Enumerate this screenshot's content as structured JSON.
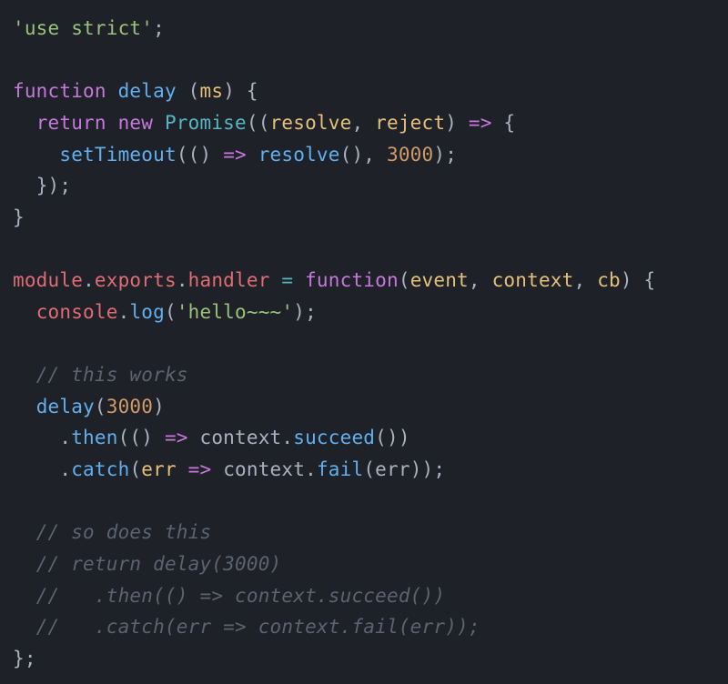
{
  "code": {
    "l1_str": "'use strict'",
    "l1_semi": ";",
    "l3_kw_function": "function",
    "l3_fn_delay": "delay",
    "l3_open": " (",
    "l3_ms": "ms",
    "l3_close": ") {",
    "l4_indent": "  ",
    "l4_return": "return",
    "l4_sp": " ",
    "l4_new": "new",
    "l4_sp2": " ",
    "l4_promise": "Promise",
    "l4_open": "((",
    "l4_resolve": "resolve",
    "l4_comma": ", ",
    "l4_reject": "reject",
    "l4_close": ") ",
    "l4_arrow": "=>",
    "l4_brace": " {",
    "l5_indent": "    ",
    "l5_setTimeout": "setTimeout",
    "l5_open": "(() ",
    "l5_arrow": "=>",
    "l5_sp": " ",
    "l5_resolve": "resolve",
    "l5_paren": "(), ",
    "l5_num": "3000",
    "l5_close": ");",
    "l6_indent": "  ",
    "l6_close": "});",
    "l7_close": "}",
    "l9_module": "module",
    "l9_dot1": ".",
    "l9_exports": "exports",
    "l9_dot2": ".",
    "l9_handler": "handler",
    "l9_sp": " ",
    "l9_eq": "=",
    "l9_sp2": " ",
    "l9_function": "function",
    "l9_open": "(",
    "l9_event": "event",
    "l9_c1": ", ",
    "l9_context": "context",
    "l9_c2": ", ",
    "l9_cb": "cb",
    "l9_close": ") {",
    "l10_indent": "  ",
    "l10_console": "console",
    "l10_dot": ".",
    "l10_log": "log",
    "l10_open": "(",
    "l10_str": "'hello~~~'",
    "l10_close": ");",
    "l12_indent": "  ",
    "l12_comment": "// this works",
    "l13_indent": "  ",
    "l13_delay": "delay",
    "l13_open": "(",
    "l13_num": "3000",
    "l13_close": ")",
    "l14_indent": "    ",
    "l14_dot": ".",
    "l14_then": "then",
    "l14_open": "(() ",
    "l14_arrow": "=>",
    "l14_sp": " ",
    "l14_context": "context",
    "l14_dot2": ".",
    "l14_succeed": "succeed",
    "l14_close": "())",
    "l15_indent": "    ",
    "l15_dot": ".",
    "l15_catch": "catch",
    "l15_open": "(",
    "l15_err": "err",
    "l15_sp": " ",
    "l15_arrow": "=>",
    "l15_sp2": " ",
    "l15_context": "context",
    "l15_dot2": ".",
    "l15_fail": "fail",
    "l15_open2": "(",
    "l15_err2": "err",
    "l15_close": "));",
    "l17_indent": "  ",
    "l17_comment": "// so does this",
    "l18_indent": "  ",
    "l18_comment": "// return delay(3000)",
    "l19_indent": "  ",
    "l19_comment": "//   .then(() => context.succeed())",
    "l20_indent": "  ",
    "l20_comment": "//   .catch(err => context.fail(err));",
    "l21_close": "};"
  }
}
